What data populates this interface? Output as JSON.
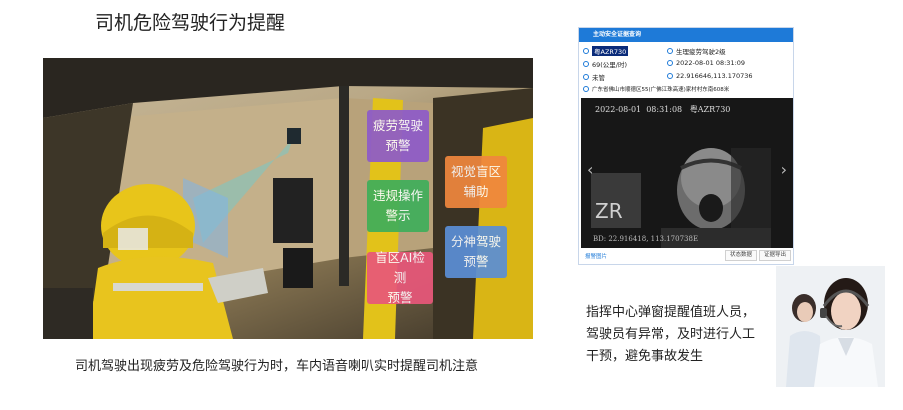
{
  "page": {
    "title": "司机危险驾驶行为提醒",
    "caption_left": "司机驾驶出现疲劳及危险驾驶行为时，车内语音喇叭实时提醒司机注意",
    "caption_right": "指挥中心弹窗提醒值班人员，驾驶员有异常，及时进行人工干预，避免事故发生"
  },
  "photo": {
    "tags": {
      "fatigue": [
        "疲劳驾驶",
        "预警"
      ],
      "violation": [
        "违规操作",
        "警示"
      ],
      "blindspot_visual": [
        "视觉盲区",
        "辅助"
      ],
      "distraction": [
        "分神驾驶",
        "预警"
      ],
      "blindspot_ai": [
        "盲区AI检测",
        "预警"
      ]
    }
  },
  "panel": {
    "header": "主动安全证据查询",
    "plate": "粤AZR730",
    "alarm": "生理疲劳驾驶2级",
    "speed": "69(公里/时)",
    "datetime": "2022-08-01 08:31:09",
    "status": "未管",
    "coords": "22.916646,113.170736",
    "address": "广东省佛山市顺德区55(广佛江珠高速)家村村东南608米",
    "camera": {
      "timestamp": "2022-08-01  08:31:08   粤AZR730",
      "bd_line": "BD: 22.916418, 113.170738E",
      "prev_arrow": "‹",
      "next_arrow": "›"
    },
    "footer": {
      "link": "报警图片",
      "btn_status": "状态数据",
      "btn_export": "证据导出"
    }
  }
}
